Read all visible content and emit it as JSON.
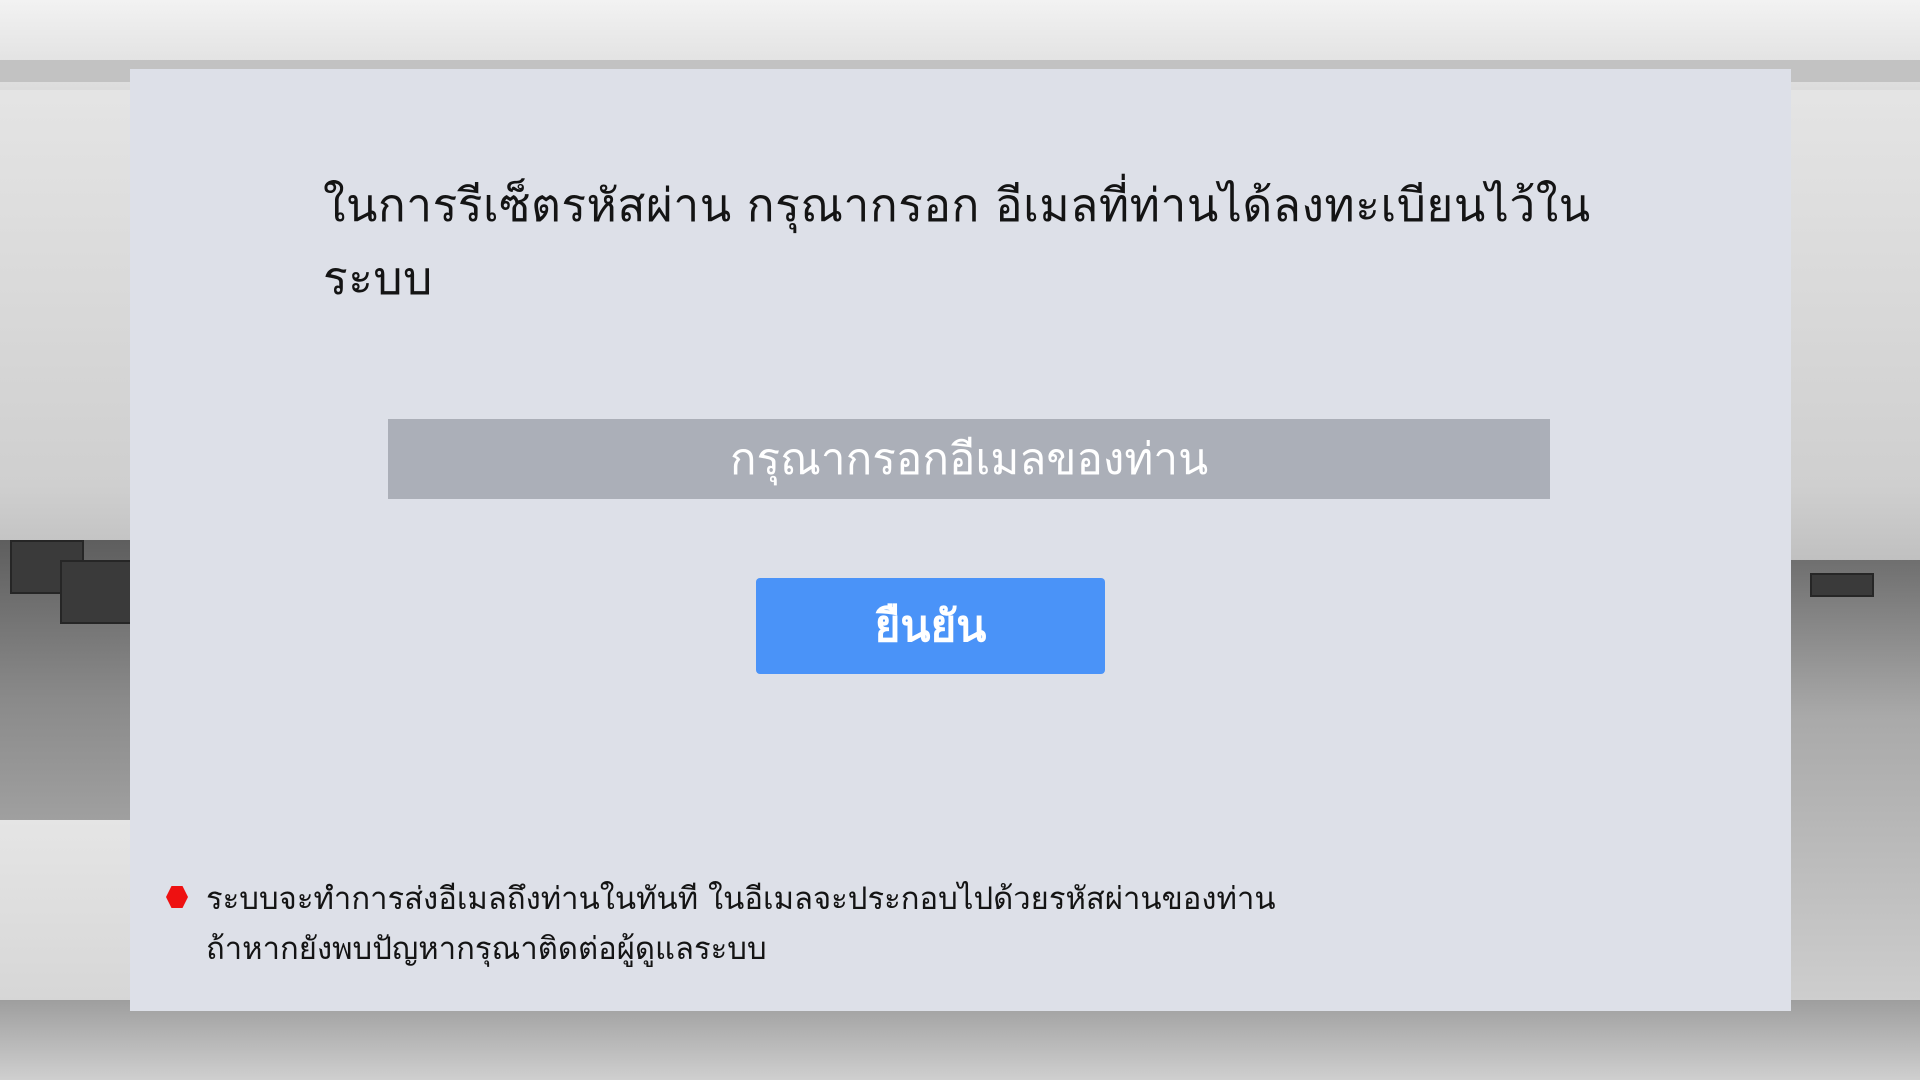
{
  "page": {
    "heading": "ในการรีเซ็ตรหัสผ่าน กรุณากรอก อีเมลที่ท่านได้ลงทะเบียนไว้ในระบบ",
    "email_input": {
      "value": "",
      "placeholder": "กรุณากรอกอีเมลของท่าน"
    },
    "confirm_label": "ยืนยัน",
    "note": {
      "line1": "ระบบจะทำการส่งอีเมลถึงท่านในทันที ในอีเมลจะประกอบไปด้วยรหัสผ่านของท่าน",
      "line2": "ถ้าหากยังพบปัญหากรุณาติดต่อผู้ดูแลระบบ"
    }
  },
  "colors": {
    "panel": "#dde0e8",
    "input_bg": "#abafb8",
    "button": "#4a93f8",
    "bullet": "#ee1111"
  },
  "icons": {
    "bullet": "red-hexagon-bullet-icon"
  }
}
